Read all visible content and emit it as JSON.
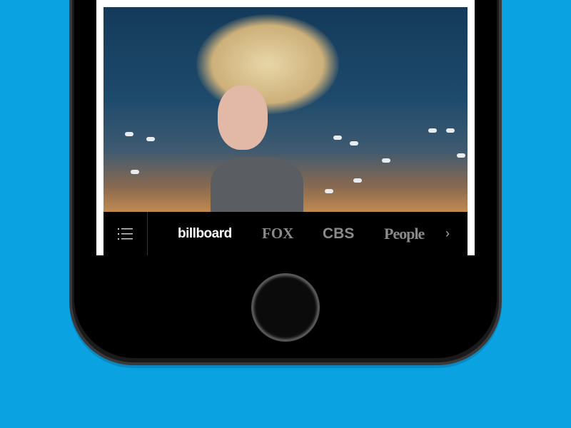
{
  "nav": {
    "menu_icon": "hamburger-list-icon",
    "logos": [
      "billboard",
      "FOX",
      "CBS",
      "People"
    ],
    "next_icon": "chevron-right-icon"
  },
  "colors": {
    "background": "#0ba2e2",
    "active_logo": "#ffffff",
    "inactive_logo": "#8a8a8a"
  }
}
